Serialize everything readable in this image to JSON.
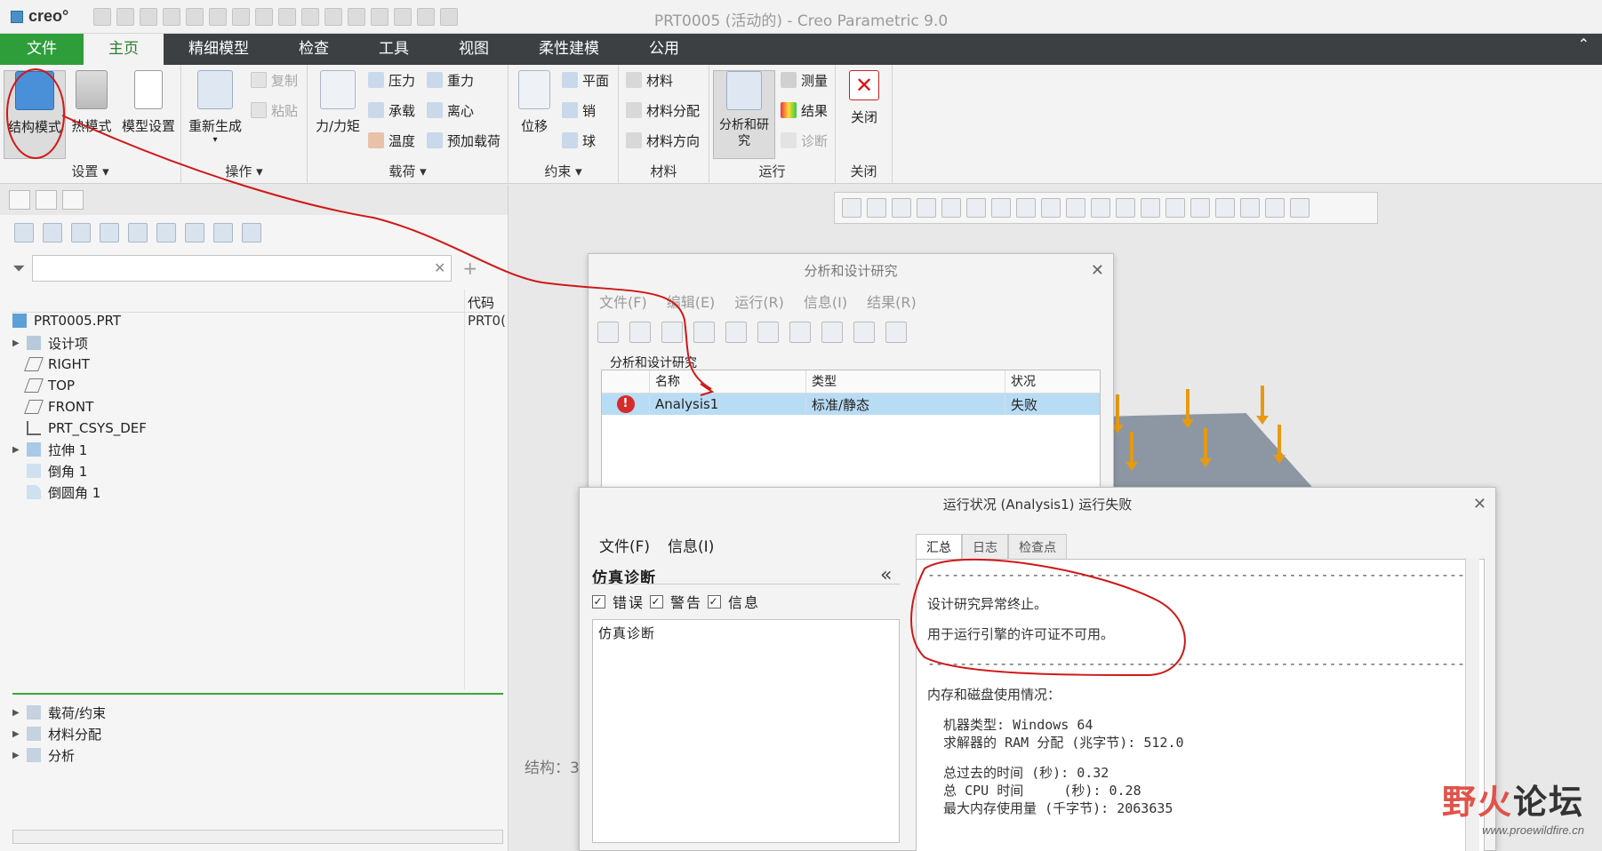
{
  "app": {
    "logo_text": "creo°",
    "window_title": "PRT0005 (活动的) - Creo Parametric 9.0"
  },
  "ribbon_tabs": [
    "文件",
    "主页",
    "精细模型",
    "检查",
    "工具",
    "视图",
    "柔性建模",
    "公用"
  ],
  "ribbon": {
    "setup": {
      "label": "设置",
      "structure_mode": "结构模式",
      "thermal_mode": "热模式",
      "model_setup": "模型设置"
    },
    "operations": {
      "label": "操作",
      "regenerate": "重新生成",
      "copy": "复制",
      "paste": "粘贴"
    },
    "loads": {
      "label": "载荷",
      "force_moment": "力/力矩",
      "pressure": "压力",
      "bearing": "承载",
      "temperature": "温度",
      "gravity": "重力",
      "centrifugal": "离心",
      "preload": "预加载荷"
    },
    "constraints": {
      "label": "约束",
      "displacement": "位移",
      "plane": "平面",
      "pin": "销",
      "ball": "球"
    },
    "material": {
      "label": "材料",
      "material": "材料",
      "material_assignment": "材料分配",
      "material_orientation": "材料方向"
    },
    "run": {
      "label": "运行",
      "analysis_study": "分析和研究",
      "measure": "测量",
      "results": "结果",
      "diagnostics": "诊断"
    },
    "close": {
      "label": "关闭",
      "close": "关闭"
    }
  },
  "model_tree": {
    "col_code": "代码",
    "items": [
      {
        "label": "PRT0005.PRT",
        "code": "PRT0("
      },
      {
        "label": "设计项"
      },
      {
        "label": "RIGHT"
      },
      {
        "label": "TOP"
      },
      {
        "label": "FRONT"
      },
      {
        "label": "PRT_CSYS_DEF"
      },
      {
        "label": "拉伸 1"
      },
      {
        "label": "倒角 1"
      },
      {
        "label": "倒圆角 1"
      }
    ],
    "sim_items": [
      {
        "label": "载荷/约束"
      },
      {
        "label": "材料分配"
      },
      {
        "label": "分析"
      }
    ]
  },
  "graphics": {
    "status_text": "结构：3"
  },
  "analysis_dialog": {
    "title": "分析和设计研究",
    "menu": [
      "文件(F)",
      "编辑(E)",
      "运行(R)",
      "信息(I)",
      "结果(R)"
    ],
    "section_label": "分析和设计研究",
    "columns": [
      "名称",
      "类型",
      "状况"
    ],
    "rows": [
      {
        "name": "Analysis1",
        "type": "标准/静态",
        "status": "失败"
      }
    ]
  },
  "run_dialog": {
    "title": "运行状况 (Analysis1) 运行失败",
    "menu": [
      "文件(F)",
      "信息(I)"
    ],
    "diag_title": "仿真诊断",
    "checks": [
      "错误",
      "警告",
      "信息"
    ],
    "diag_item": "仿真诊断",
    "tabs": [
      "汇总",
      "日志",
      "检查点"
    ],
    "log_lines": [
      "设计研究异常终止。",
      "用于运行引擎的许可证不可用。",
      "内存和磁盘使用情况：",
      "  机器类型: Windows 64",
      "  求解器的 RAM 分配 (兆字节): 512.0",
      "  总过去的时间 (秒): 0.32",
      "  总 CPU 时间     (秒): 0.28",
      "  最大内存使用量 (千字节): 2063635"
    ]
  },
  "watermark": {
    "text_a": "野火",
    "text_b": "论坛",
    "url": "www.proewildfire.cn"
  },
  "colors": {
    "accent_green": "#2e9e3a",
    "tab_bar": "#3c4043",
    "selected_row": "#b9dcf5",
    "annotation_red": "#d01818",
    "force_arrow": "#e69a12"
  }
}
